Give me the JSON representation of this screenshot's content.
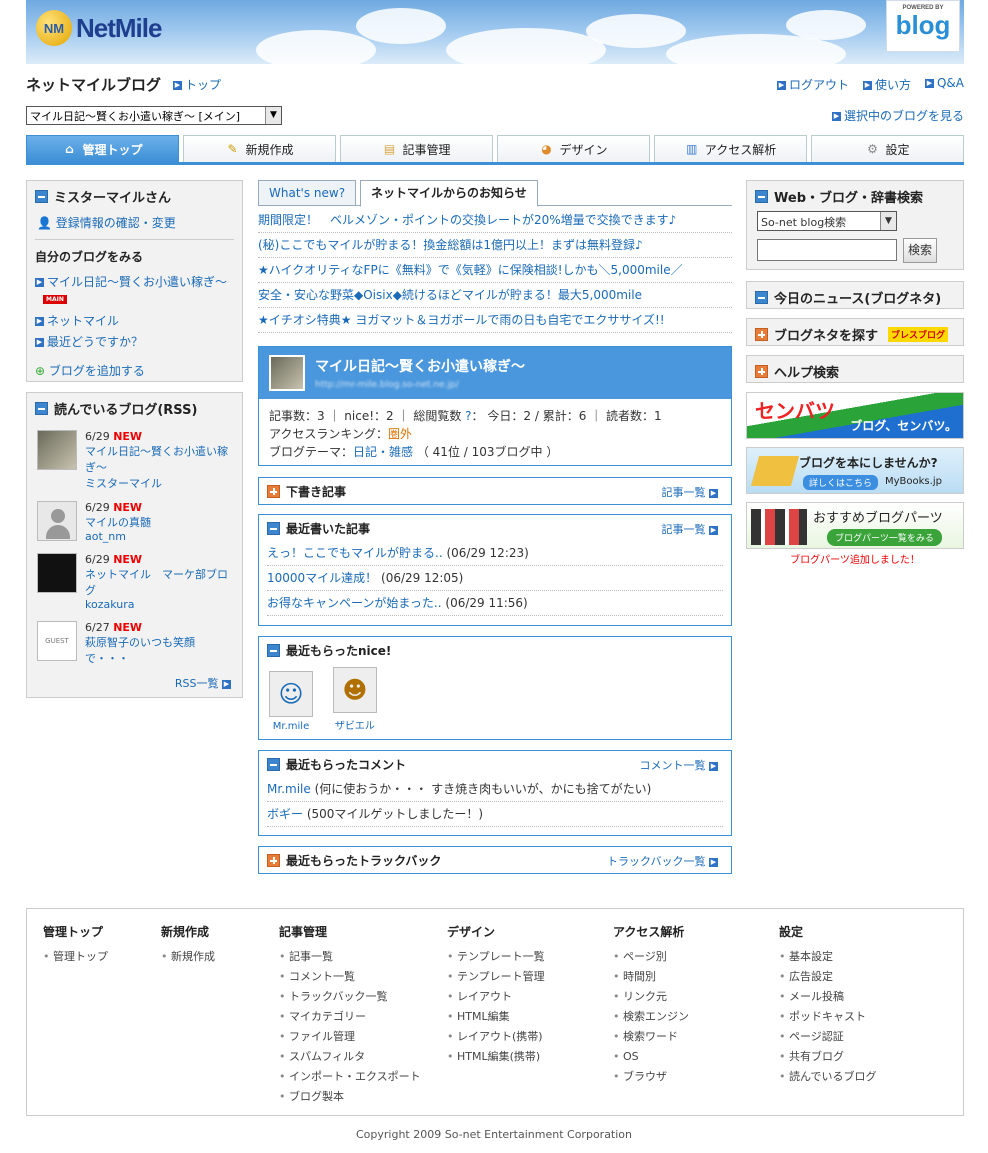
{
  "brand": {
    "logo_mark": "NM",
    "logo_text": "NetMile",
    "powered_by": "POWERED BY",
    "blog_badge": "blog"
  },
  "site": {
    "title": "ネットマイルブログ",
    "top_link": "トップ",
    "logout": "ログアウト",
    "howto": "使い方",
    "qa": "Q&A",
    "see_blog": "選択中のブログを見る"
  },
  "blog_select": {
    "value": "マイル日記～賢くお小遣い稼ぎ～ [メイン]"
  },
  "tabs": [
    {
      "label": "管理トップ",
      "icon": "home-icon"
    },
    {
      "label": "新規作成",
      "icon": "pencil-icon"
    },
    {
      "label": "記事管理",
      "icon": "folder-icon"
    },
    {
      "label": "デザイン",
      "icon": "palette-icon"
    },
    {
      "label": "アクセス解析",
      "icon": "bar-chart-icon"
    },
    {
      "label": "設定",
      "icon": "gear-icon"
    }
  ],
  "user_box": {
    "name": "ミスターマイルさん",
    "profile_link": "登録情報の確認・変更",
    "my_blogs_heading": "自分のブログをみる",
    "blog1": "マイル日記～賢くお小遣い稼ぎ～",
    "main_badge": "MAIN",
    "blog2": "ネットマイル",
    "blog3": "最近どうですか？",
    "add_blog": "ブログを追加する"
  },
  "rss_box": {
    "heading": "読んでいるブログ(RSS)",
    "new_label": "NEW",
    "items": [
      {
        "date": "6/29",
        "title": "マイル日記～賢くお小遣い稼ぎ～",
        "author": "ミスターマイル"
      },
      {
        "date": "6/29",
        "title": "マイルの真髄",
        "author": "aot_nm"
      },
      {
        "date": "6/29",
        "title": "ネットマイル　マーケ部ブログ",
        "author": "kozakura"
      },
      {
        "date": "6/27",
        "title": "萩原智子のいつも笑顔で・・・",
        "author": ""
      }
    ],
    "guest_label": "GUEST",
    "rss_list": "RSS一覧"
  },
  "news_tabs": {
    "whats_new": "What's new?",
    "notice": "ネットマイルからのお知らせ"
  },
  "news": [
    "期間限定！　ベルメゾン・ポイントの交換レートが20%増量で交換できます♪",
    "(秘)ここでもマイルが貯まる！換金総額は1億円以上！まずは無料登録♪",
    "★ハイクオリティなFPに《無料》で《気軽》に保険相談!しかも＼5,000mile／",
    "安全・安心な野菜◆Oisix◆続けるほどマイルが貯まる！最大5,000mile",
    "★イチオシ特典★ ヨガマット＆ヨガボールで雨の日も自宅でエクササイズ!!"
  ],
  "blog_card": {
    "title": "マイル日記～賢くお小遣い稼ぎ～",
    "url": "http://mr-mile.blog.so-net.ne.jp/",
    "articles_label": "記事数：",
    "articles": "3",
    "nice_label": "nice!：",
    "nice": "2",
    "views_label": "総閲覧数",
    "help_q": "?",
    "views_sep": "：",
    "today_label": "今日：",
    "today": "2",
    "total_label": "累計：",
    "total": "6",
    "readers_label": "読者数：",
    "readers": "1",
    "ranking_label": "アクセスランキング：",
    "ranking": "圏外",
    "theme_label": "ブログテーマ：",
    "theme": "日記・雑感",
    "theme_rank": "（ 41位 / 103ブログ中 ）"
  },
  "drafts": {
    "heading": "下書き記事",
    "more": "記事一覧"
  },
  "recent_posts": {
    "heading": "最近書いた記事",
    "more": "記事一覧",
    "items": [
      {
        "title": "えっ！ここでもマイルが貯まる..",
        "date": "(06/29 12:23)"
      },
      {
        "title": "10000マイル達成！",
        "date": "(06/29 12:05)"
      },
      {
        "title": "お得なキャンペーンが始まった..",
        "date": "(06/29 11:56)"
      }
    ]
  },
  "recent_nice": {
    "heading": "最近もらったnice!",
    "users": [
      "Mr.mile",
      "ザビエル"
    ]
  },
  "recent_comments": {
    "heading": "最近もらったコメント",
    "more": "コメント一覧",
    "items": [
      {
        "user": "Mr.mile",
        "text": "(何に使おうか・・・ すき焼き肉もいいが、かにも捨てがたい)"
      },
      {
        "user": "ボギー",
        "text": "(500マイルゲットしましたー！)"
      }
    ]
  },
  "recent_trackbacks": {
    "heading": "最近もらったトラックバック",
    "more": "トラックバック一覧"
  },
  "right": {
    "search_heading": "Web・ブログ・辞書検索",
    "search_select": "So-net blog検索",
    "search_button": "検索",
    "news_heading": "今日のニュース(ブログネタ)",
    "neta_heading": "ブログネタを探す",
    "neta_logo": "ブレスブログ",
    "help_heading": "ヘルプ検索",
    "senbatsu_title": "センバツ",
    "senbatsu_sub": "ブログ、センバツ。",
    "book_title": "ブログを本にしませんか?",
    "book_btn": "詳しくはこちら",
    "book_brand": "MyBooks.jp",
    "parts_title": "おすすめブログパーツ",
    "parts_btn": "ブログパーツ一覧をみる",
    "parts_note": "ブログパーツ追加しました！"
  },
  "footer": {
    "cols": [
      {
        "head": "管理トップ",
        "items": [
          "管理トップ"
        ]
      },
      {
        "head": "新規作成",
        "items": [
          "新規作成"
        ]
      },
      {
        "head": "記事管理",
        "items": [
          "記事一覧",
          "コメント一覧",
          "トラックバック一覧",
          "マイカテゴリー",
          "ファイル管理",
          "スパムフィルタ",
          "インポート・エクスポート",
          "ブログ製本"
        ]
      },
      {
        "head": "デザイン",
        "items": [
          "テンプレート一覧",
          "テンプレート管理",
          "レイアウト",
          "HTML編集",
          "レイアウト(携帯)",
          "HTML編集(携帯)"
        ]
      },
      {
        "head": "アクセス解析",
        "items": [
          "ページ別",
          "時間別",
          "リンク元",
          "検索エンジン",
          "検索ワード",
          "OS",
          "ブラウザ"
        ]
      },
      {
        "head": "設定",
        "items": [
          "基本設定",
          "広告設定",
          "メール投稿",
          "ポッドキャスト",
          "ページ認証",
          "共有ブログ",
          "読んでいるブログ"
        ]
      }
    ],
    "copyright": "Copyright 2009 So-net Entertainment Corporation"
  },
  "colors": {
    "accent": "#3d8fd6",
    "link": "#1a6ab8",
    "new": "#e00000",
    "orange": "#e07000"
  }
}
